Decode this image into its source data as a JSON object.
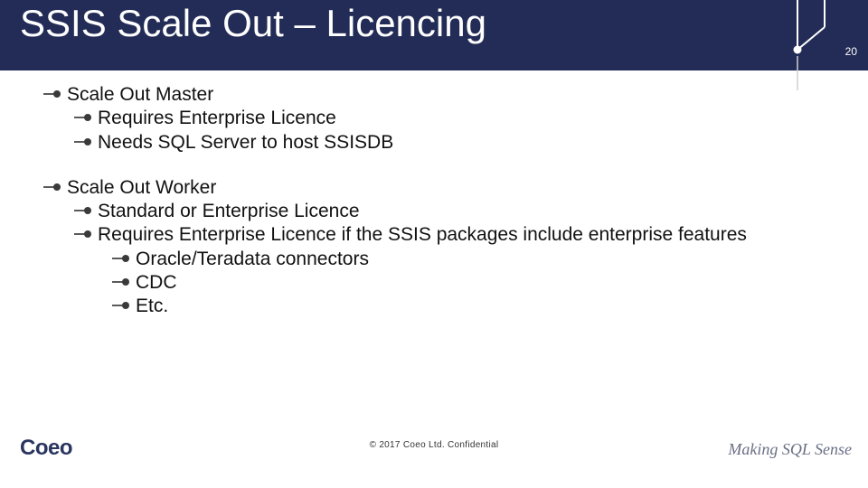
{
  "header": {
    "title": "SSIS Scale Out – Licencing",
    "slide_number": "20"
  },
  "content": {
    "g1": {
      "title": "Scale Out Master",
      "i1": "Requires Enterprise Licence",
      "i2": "Needs SQL Server to host SSISDB"
    },
    "g2": {
      "title": "Scale Out Worker",
      "i1": "Standard or Enterprise Licence",
      "i2": "Requires Enterprise Licence if the SSIS packages include enterprise features",
      "s1": "Oracle/Teradata connectors",
      "s2": "CDC",
      "s3": "Etc."
    }
  },
  "footer": {
    "copyright": "© 2017 Coeo Ltd. Confidential",
    "logo": "Coeo",
    "tagline": "Making SQL Sense"
  }
}
